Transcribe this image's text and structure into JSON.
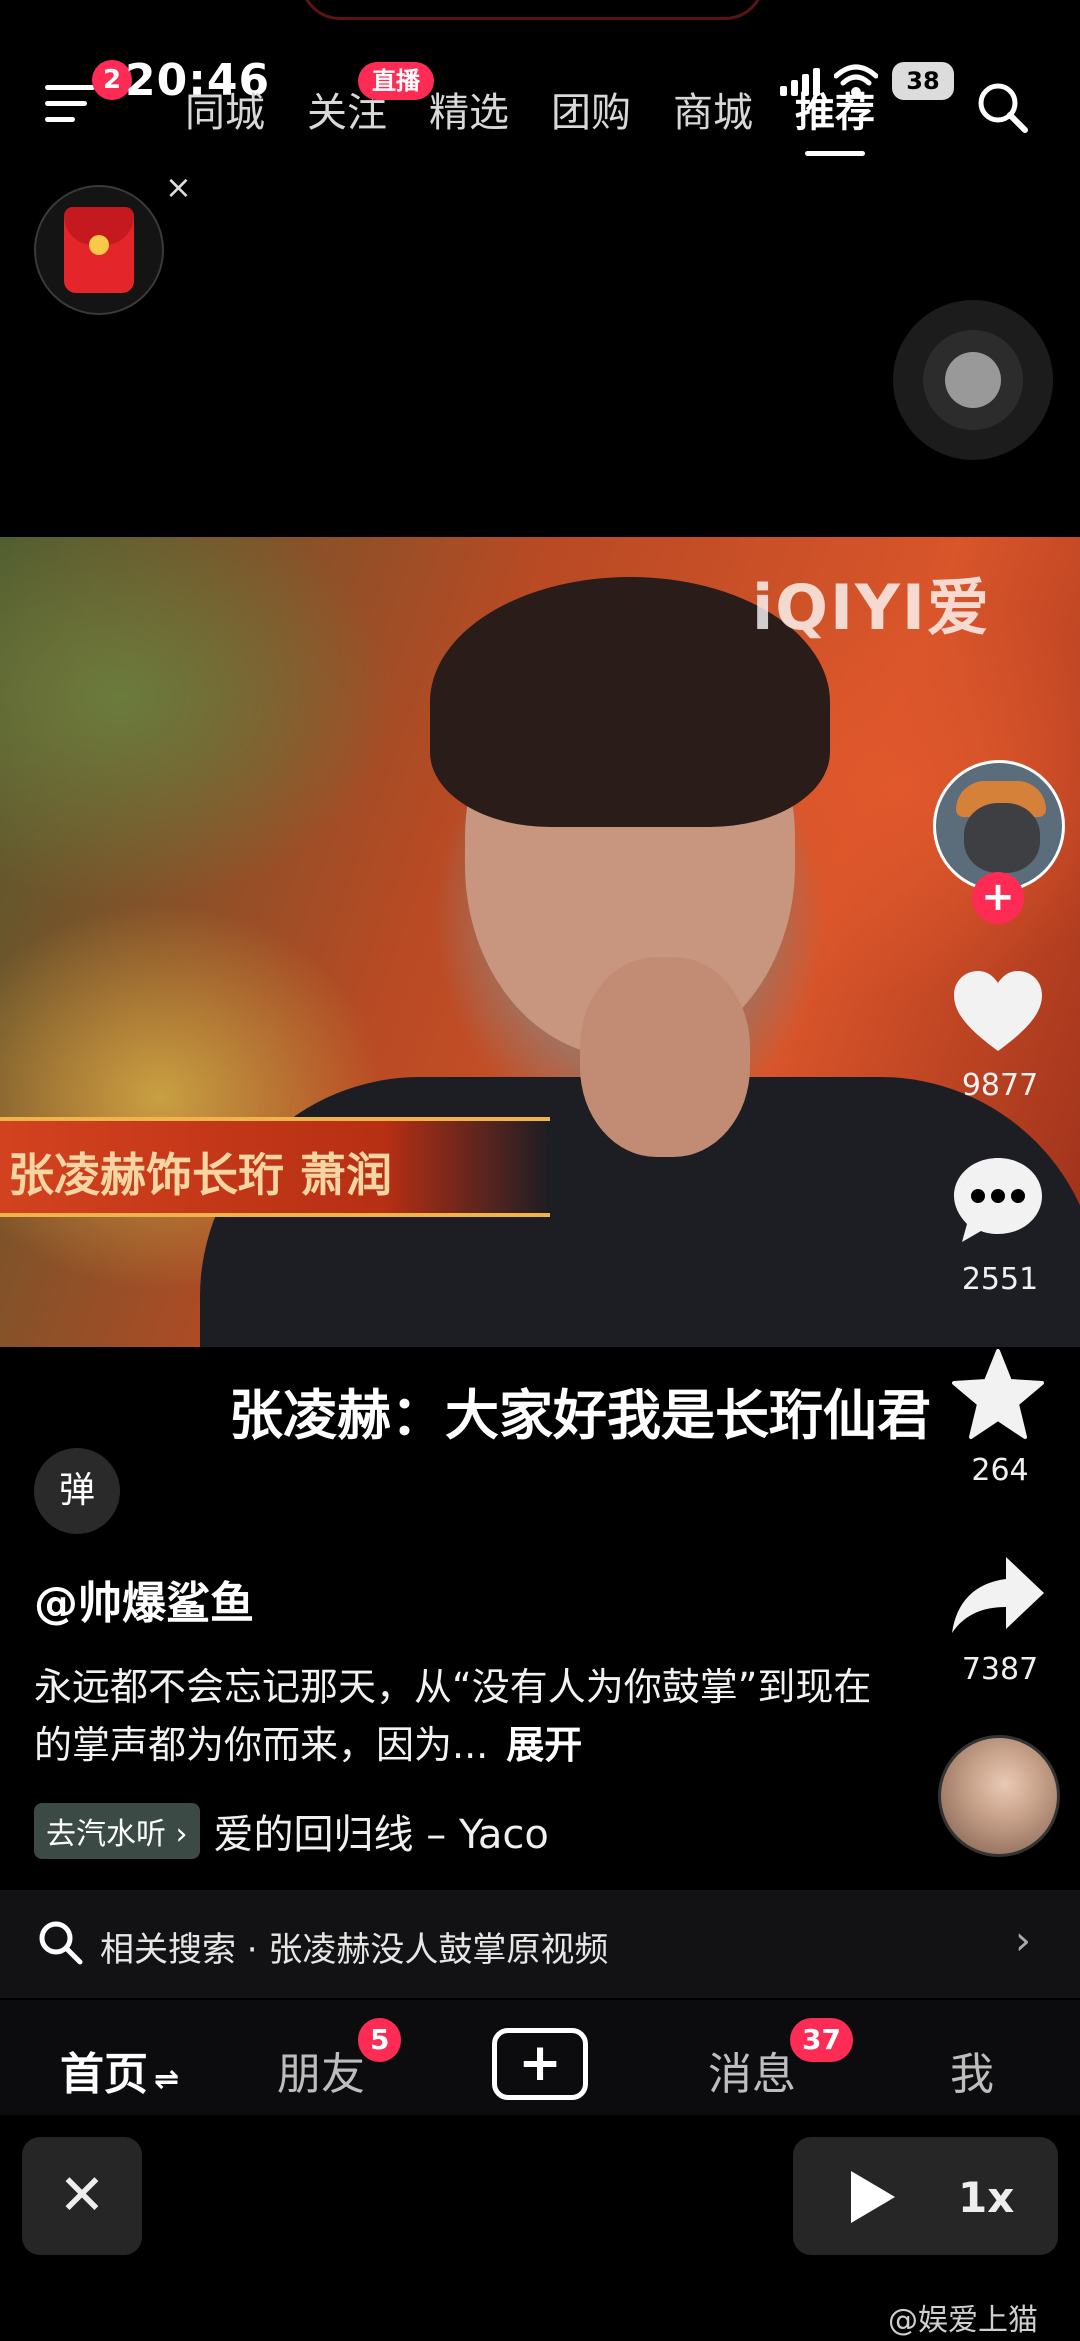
{
  "status": {
    "time": "20:46",
    "battery": "38"
  },
  "top_nav": {
    "menu_badge": "2",
    "live_badge": "直播",
    "tabs": [
      {
        "label": "同城"
      },
      {
        "label": "关注"
      },
      {
        "label": "精选"
      },
      {
        "label": "团购"
      },
      {
        "label": "商城"
      },
      {
        "label": "推荐",
        "active": true
      }
    ]
  },
  "red_packet": {
    "close": "×"
  },
  "video": {
    "watermark": "iQIYI爱",
    "caption_banner": "张凌赫饰长珩 萧润"
  },
  "actions": {
    "like_count": "9877",
    "comment_count": "2551",
    "favorite_count": "264",
    "share_count": "7387",
    "follow_plus": "+"
  },
  "post": {
    "subtitle": "张凌赫：大家好我是长珩仙君",
    "danmaku_label": "弹",
    "author": "@帅爆鲨鱼",
    "description": "永远都不会忘记那天，从“没有人为你鼓掌”到现在的掌声都为你而来，因为...",
    "expand_label": "展开",
    "music_chip": "去汽水听 ›",
    "music_name": "爱的回归线 – Yaco"
  },
  "related_search": {
    "text": "相关搜索 · 张凌赫没人鼓掌原视频",
    "chevron": "›"
  },
  "bottom_nav": {
    "home": "首页",
    "home_suffix": "⇌",
    "friends": "朋友",
    "friends_badge": "5",
    "plus": "+",
    "messages": "消息",
    "messages_badge": "37",
    "me": "我"
  },
  "player": {
    "close": "✕",
    "speed": "1x"
  },
  "footer_watermark": "@娱爱上猫",
  "colors": {
    "accent": "#fe2c55",
    "background": "#000000"
  }
}
